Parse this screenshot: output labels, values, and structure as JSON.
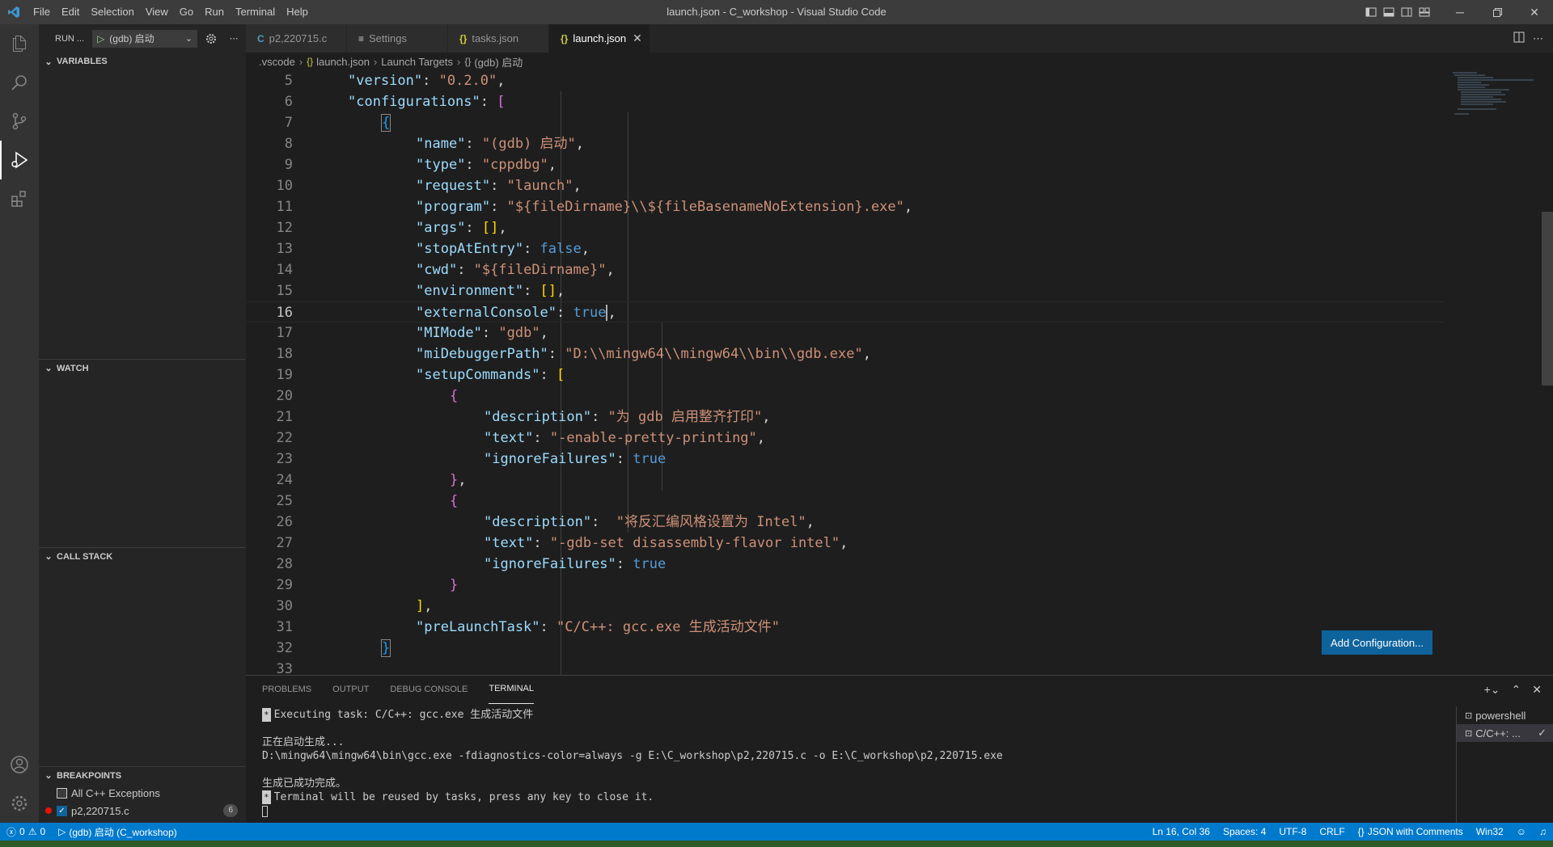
{
  "window": {
    "title": "launch.json - C_workshop - Visual Studio Code"
  },
  "menu": [
    "File",
    "Edit",
    "Selection",
    "View",
    "Go",
    "Run",
    "Terminal",
    "Help"
  ],
  "sidebar": {
    "run_title": "RUN ...",
    "config_name": "(gdb) 启动",
    "sections": {
      "variables": "VARIABLES",
      "watch": "WATCH",
      "call_stack": "CALL STACK",
      "breakpoints": "BREAKPOINTS"
    },
    "breakpoints": [
      {
        "label": "All C++ Exceptions",
        "checked": false
      },
      {
        "label": "p2,220715.c",
        "checked": true,
        "count": "6"
      }
    ]
  },
  "tabs": [
    {
      "icon": "C",
      "label": "p2,220715.c",
      "active": false
    },
    {
      "icon": "≡",
      "label": "Settings",
      "active": false
    },
    {
      "icon": "{}",
      "label": "tasks.json",
      "active": false
    },
    {
      "icon": "{}",
      "label": "launch.json",
      "active": true
    }
  ],
  "breadcrumbs": {
    "folder": ".vscode",
    "file": "launch.json",
    "section": "Launch Targets",
    "item": "(gdb) 启动"
  },
  "editor": {
    "line_numbers": [
      "5",
      "6",
      "7",
      "8",
      "9",
      "10",
      "11",
      "12",
      "13",
      "14",
      "15",
      "16",
      "17",
      "18",
      "19",
      "20",
      "21",
      "22",
      "23",
      "24",
      "25",
      "26",
      "27",
      "28",
      "29",
      "30",
      "31",
      "32",
      "33"
    ],
    "current_line": "16",
    "lines": {
      "l5_key": "\"version\"",
      "l5_val": "\"0.2.0\"",
      "l6_key": "\"configurations\"",
      "l8_key": "\"name\"",
      "l8_val": "\"(gdb) 启动\"",
      "l9_key": "\"type\"",
      "l9_val": "\"cppdbg\"",
      "l10_key": "\"request\"",
      "l10_val": "\"launch\"",
      "l11_key": "\"program\"",
      "l11_val": "\"${fileDirname}\\\\${fileBasenameNoExtension}.exe\"",
      "l12_key": "\"args\"",
      "l13_key": "\"stopAtEntry\"",
      "l13_val": "false",
      "l14_key": "\"cwd\"",
      "l14_val": "\"${fileDirname}\"",
      "l15_key": "\"environment\"",
      "l16_key": "\"externalConsole\"",
      "l16_val": "true",
      "l17_key": "\"MIMode\"",
      "l17_val": "\"gdb\"",
      "l18_key": "\"miDebuggerPath\"",
      "l18_val": "\"D:\\\\mingw64\\\\mingw64\\\\bin\\\\gdb.exe\"",
      "l19_key": "\"setupCommands\"",
      "l21_key": "\"description\"",
      "l21_val": "\"为 gdb 启用整齐打印\"",
      "l22_key": "\"text\"",
      "l22_val": "\"-enable-pretty-printing\"",
      "l23_key": "\"ignoreFailures\"",
      "l23_val": "true",
      "l26_key": "\"description\"",
      "l26_val": "\"将反汇编风格设置为 Intel\"",
      "l27_key": "\"text\"",
      "l27_val": "\"-gdb-set disassembly-flavor intel\"",
      "l28_key": "\"ignoreFailures\"",
      "l28_val": "true",
      "l31_key": "\"preLaunchTask\"",
      "l31_val": "\"C/C++: gcc.exe 生成活动文件\""
    },
    "add_config_label": "Add Configuration..."
  },
  "panel": {
    "tabs": [
      "PROBLEMS",
      "OUTPUT",
      "DEBUG CONSOLE",
      "TERMINAL"
    ],
    "active_tab": "TERMINAL",
    "terminal_lines": {
      "t1": "Executing task: C/C++: gcc.exe 生成活动文件",
      "t2": "正在启动生成...",
      "t3": "D:\\mingw64\\mingw64\\bin\\gcc.exe -fdiagnostics-color=always -g E:\\C_workshop\\p2,220715.c -o E:\\C_workshop\\p2,220715.exe",
      "t4": "生成已成功完成。",
      "t5": "Terminal will be reused by tasks, press any key to close it."
    },
    "terminals": [
      "powershell",
      "C/C++: ..."
    ]
  },
  "statusbar": {
    "errors": "0",
    "warnings": "0",
    "debug_target": "(gdb) 启动 (C_workshop)",
    "position": "Ln 16, Col 36",
    "spaces": "Spaces: 4",
    "encoding": "UTF-8",
    "eol": "CRLF",
    "language": "JSON with Comments",
    "platform": "Win32"
  },
  "colors": {
    "accent": "#007acc",
    "button": "#0e639c",
    "breakpoint": "#e51400"
  }
}
